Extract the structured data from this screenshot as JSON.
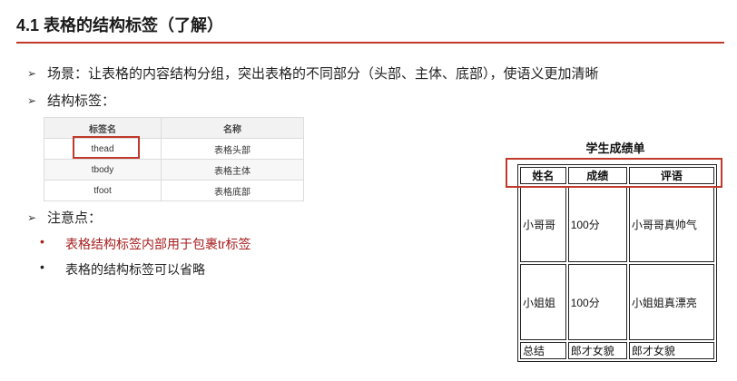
{
  "title": "4.1 表格的结构标签（了解）",
  "bullets": {
    "scene": "场景：让表格的内容结构分组，突出表格的不同部分（头部、主体、底部），使语义更加清晰",
    "struct_tags": "结构标签：",
    "notes": "注意点：",
    "note1": "表格结构标签内部用于包裹tr标签",
    "note2": "表格的结构标签可以省略"
  },
  "ref_table": {
    "headers": [
      "标签名",
      "名称"
    ],
    "rows": [
      [
        "thead",
        "表格头部"
      ],
      [
        "tbody",
        "表格主体"
      ],
      [
        "tfoot",
        "表格底部"
      ]
    ]
  },
  "student_table": {
    "caption": "学生成绩单",
    "headers": [
      "姓名",
      "成绩",
      "评语"
    ],
    "rows": [
      [
        "小哥哥",
        "100分",
        "小哥哥真帅气"
      ],
      [
        "小姐姐",
        "100分",
        "小姐姐真漂亮"
      ]
    ],
    "footer": [
      "总结",
      "郎才女貌",
      "郎才女貌"
    ]
  },
  "colors": {
    "accent": "#c0392b",
    "note_red": "#a61e1e"
  }
}
